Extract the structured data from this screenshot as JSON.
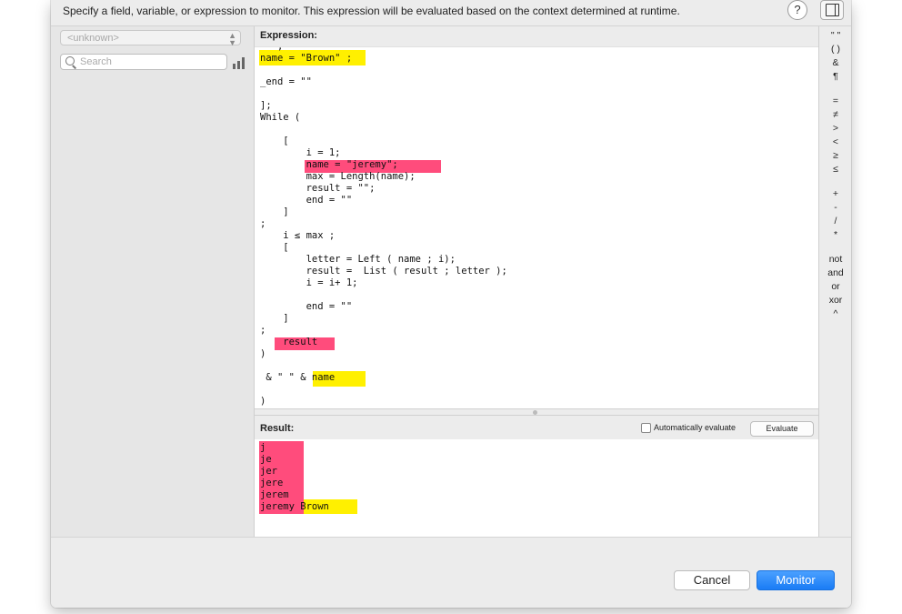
{
  "header": {
    "instructions": "Specify a field, variable, or expression to monitor. This expression will be evaluated based on the context determined at runtime.",
    "help_label": "?"
  },
  "left_pane": {
    "context_select_value": "<unknown>",
    "search_placeholder": "Search"
  },
  "expression": {
    "label": "Expression:",
    "lines": [
      "   ;",
      "name = \"Brown\" ;",
      "",
      "_end = \"\"",
      "",
      "];",
      "While (",
      "",
      "    [",
      "        i = 1;",
      "        name = \"jeremy\";",
      "        max = Length(name);",
      "        result = \"\";",
      "        end = \"\"",
      "    ]",
      ";",
      "    i ≤ max ;",
      "    [",
      "        letter = Left ( name ; i);",
      "        result =  List ( result ; letter );",
      "        i = i+ 1;",
      "",
      "        end = \"\"",
      "    ]",
      ";",
      "    result",
      ")",
      "",
      " & \" \" & name",
      "",
      ")"
    ]
  },
  "result": {
    "label": "Result:",
    "auto_evaluate_label": "Automatically evaluate",
    "evaluate_label": "Evaluate",
    "lines": [
      "j",
      "je",
      "jer",
      "jere",
      "jerem",
      "jeremy Brown"
    ]
  },
  "operators": {
    "group1": [
      "\" \"",
      "( )",
      "&",
      "¶"
    ],
    "group2": [
      "=",
      "≠",
      ">",
      "<",
      "≥",
      "≤"
    ],
    "group3": [
      "+",
      "-",
      "/",
      "*"
    ],
    "group4": [
      "not",
      "and",
      "or",
      "xor",
      "^"
    ]
  },
  "footer": {
    "cancel_label": "Cancel",
    "monitor_label": "Monitor"
  },
  "colors": {
    "highlight_yellow": "#fff000",
    "highlight_pink": "#ff4c7c",
    "primary_button": "#1a7cf5"
  }
}
